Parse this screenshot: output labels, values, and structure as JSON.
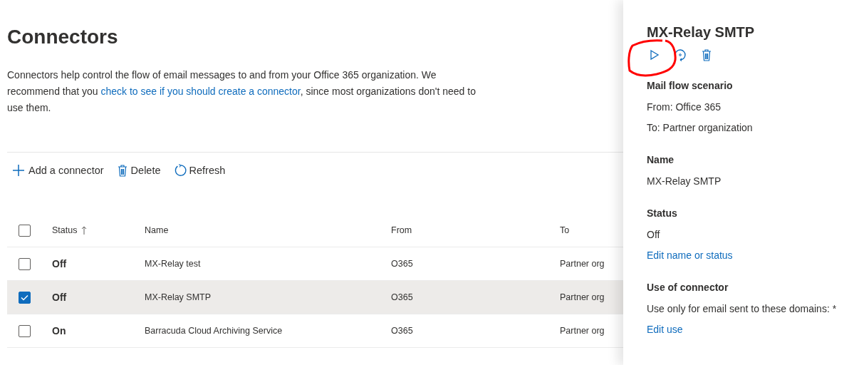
{
  "page": {
    "title": "Connectors",
    "description": "Connectors help control the flow of email messages to and from your Office 365 organization. We recommend that you ",
    "description_link": "check to see if you should create a connector",
    "description_end": ", since most organizations don't need to use them."
  },
  "toolbar": [
    {
      "kind": "add",
      "label": "Add a connector"
    },
    {
      "kind": "delete",
      "label": "Delete"
    },
    {
      "kind": "refresh",
      "label": "Refresh"
    }
  ],
  "table": {
    "all_checked": false,
    "columns": [
      {
        "label": "Status",
        "sorted": true
      },
      {
        "label": "Name",
        "sorted": false
      },
      {
        "label": "From",
        "sorted": false
      },
      {
        "label": "To",
        "sorted": false
      }
    ],
    "rows": [
      {
        "status": "Off",
        "name": "MX-Relay test",
        "from": "O365",
        "to": "Partner org",
        "selected": false
      },
      {
        "status": "Off",
        "name": "MX-Relay SMTP",
        "from": "O365",
        "to": "Partner org",
        "selected": true
      },
      {
        "status": "On",
        "name": "Barracuda Cloud Archiving Service",
        "from": "O365",
        "to": "Partner org",
        "selected": false
      }
    ]
  },
  "panel": {
    "title": "MX-Relay SMTP",
    "actions": [
      {
        "kind": "play"
      },
      {
        "kind": "refresh"
      },
      {
        "kind": "delete"
      }
    ],
    "sections": [
      {
        "heading": "Mail flow scenario",
        "lines": [
          "From: Office 365",
          "To: Partner organization"
        ]
      },
      {
        "heading": "Name",
        "lines": [
          "MX-Relay SMTP"
        ]
      },
      {
        "heading": "Status",
        "lines": [
          "Off"
        ],
        "link": "Edit name or status"
      },
      {
        "heading": "Use of connector",
        "lines": [
          "Use only for email sent to these domains: *"
        ],
        "link": "Edit use"
      }
    ]
  }
}
